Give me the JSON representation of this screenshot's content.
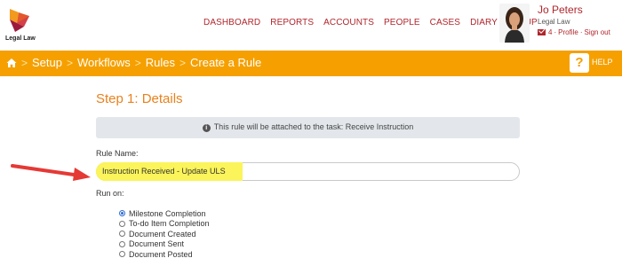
{
  "header": {
    "logo_text": "Legal Law",
    "nav": [
      "DASHBOARD",
      "REPORTS",
      "ACCOUNTS",
      "PEOPLE",
      "CASES",
      "DIARY",
      "SETUP"
    ],
    "user_name": "Jo Peters",
    "user_org": "Legal Law",
    "mail_count": "4",
    "profile_link": "Profile",
    "signout_link": "Sign out",
    "link_separator": "·"
  },
  "breadcrumb": {
    "items": [
      "Setup",
      "Workflows",
      "Rules",
      "Create a Rule"
    ],
    "separator": ">",
    "help_symbol": "?",
    "help_label": "HELP"
  },
  "content": {
    "step_title": "Step 1: Details",
    "info_icon": "i",
    "info_text": "This rule will be attached to the task: Receive Instruction",
    "rule_name_label": "Rule Name:",
    "rule_name_value": "Instruction Received - Update ULS",
    "run_on_label": "Run on:",
    "run_on_options": [
      {
        "label": "Milestone Completion",
        "selected": true
      },
      {
        "label": "To-do Item Completion",
        "selected": false
      },
      {
        "label": "Document Created",
        "selected": false
      },
      {
        "label": "Document Sent",
        "selected": false
      },
      {
        "label": "Document Posted",
        "selected": false
      }
    ]
  },
  "colors": {
    "brand_red": "#b0262c",
    "accent_orange": "#f5a000",
    "step_title": "#e8821d",
    "highlight": "#fbf45a",
    "arrow": "#e53935"
  }
}
